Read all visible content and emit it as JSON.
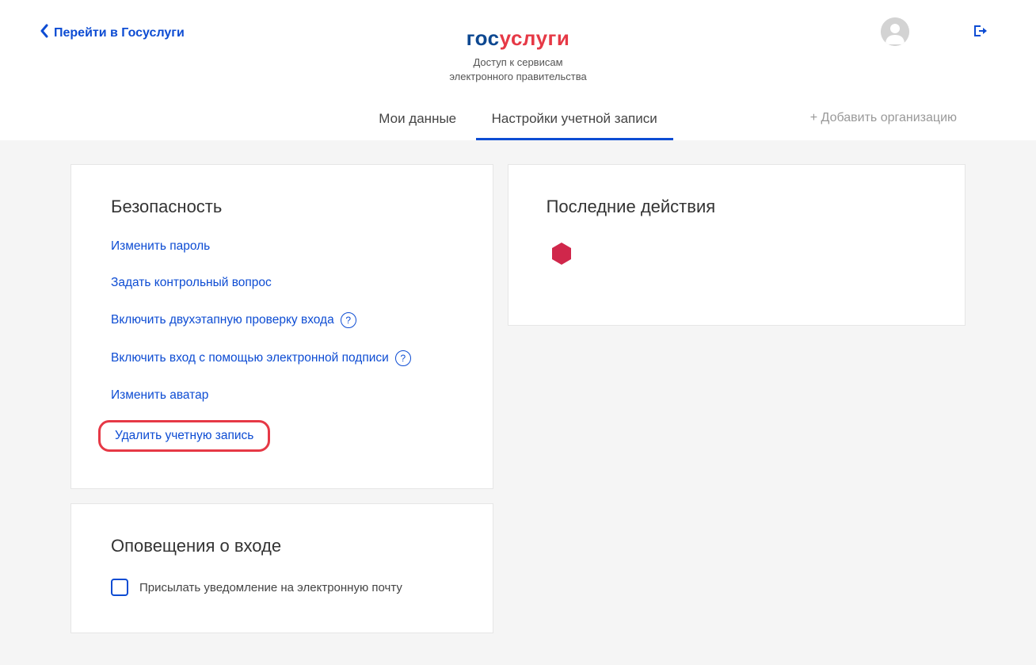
{
  "header": {
    "back_link": "Перейти в Госуслуги",
    "logo_part1": "гос",
    "logo_part2": "услуги",
    "subtitle_line1": "Доступ к сервисам",
    "subtitle_line2": "электронного правительства"
  },
  "tabs": {
    "my_data": "Мои данные",
    "account_settings": "Настройки учетной записи",
    "add_org": "+ Добавить организацию"
  },
  "security": {
    "title": "Безопасность",
    "change_password": "Изменить пароль",
    "security_question": "Задать контрольный вопрос",
    "two_step": "Включить двухэтапную проверку входа",
    "esignature": "Включить вход с помощью электронной подписи",
    "change_avatar": "Изменить аватар",
    "delete_account": "Удалить учетную запись"
  },
  "notifications": {
    "title": "Оповещения о входе",
    "email_notify": "Присылать уведомление на электронную почту"
  },
  "recent": {
    "title": "Последние действия"
  },
  "icons": {
    "help": "?"
  }
}
